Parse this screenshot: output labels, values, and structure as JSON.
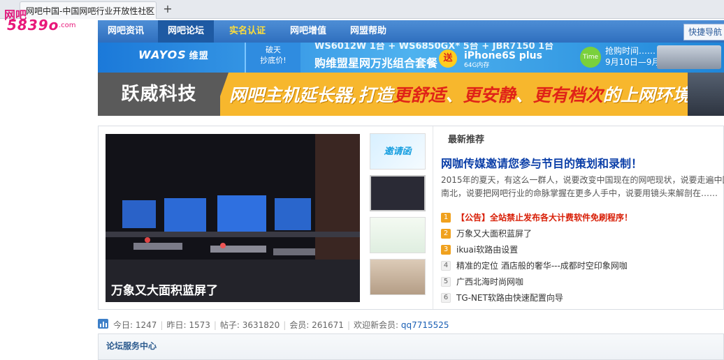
{
  "browser": {
    "tab_title": "网吧中国-中国网吧行业开放性社区",
    "tab_close": "×",
    "new_tab": "+"
  },
  "logo": {
    "line1": "网吧",
    "line2": "5839o",
    "line3": ".com"
  },
  "nav": {
    "items": [
      {
        "label": "网吧资讯"
      },
      {
        "label": "网吧论坛"
      },
      {
        "label": "实名认证"
      },
      {
        "label": "网吧增值"
      },
      {
        "label": "网盟帮助"
      }
    ],
    "right_label": "快捷导航"
  },
  "banner1": {
    "brand": "WAYOS",
    "brand_suffix": "维盟",
    "tag_line1": "破天",
    "tag_line2": "抄底价!",
    "top_text": "WS6012W 1台 + WS6850GX* 5台 + JBR7150 1台",
    "main_text": "购维盟星网万兆组合套餐",
    "song": "送",
    "phone": "iPhone6S plus",
    "phone_sub": "64G内存",
    "time_label": "Time",
    "rush_line1": "抢购时间……",
    "rush_line2": "9月10日—9月16"
  },
  "banner2": {
    "left_text": "跃威科技",
    "text_a": "网吧主机延长器,打造",
    "text_b": "更舒适",
    "text_c": "、",
    "text_d": "更安静",
    "text_e": "、",
    "text_f": "更有档次",
    "text_g": "的上网环境"
  },
  "slider": {
    "caption": "万象又大面积蓝屏了",
    "thumb1_text": "邀请函"
  },
  "recommend": {
    "title": "最新推荐",
    "headline": "网咖传媒邀请您参与节目的策划和录制！",
    "summary_line1": "2015年的夏天，有这么一群人，说要改变中国现在的网吧现状，说要走遍中国",
    "summary_line2": "南北，说要把网吧行业的命脉掌握在更多人手中，说要用镜头来解剖在……"
  },
  "hot_list": [
    {
      "num": "1",
      "text": "【公告】全站禁止发布各大计费软件免刷程序！"
    },
    {
      "num": "2",
      "text": "万象又大面积蓝屏了"
    },
    {
      "num": "3",
      "text": "ikuai软路由设置"
    },
    {
      "num": "4",
      "text": "精准的定位 酒店般的奢华---成都时空印象网咖"
    },
    {
      "num": "5",
      "text": "广西北海时尚网咖"
    },
    {
      "num": "6",
      "text": "TG-NET软路由快速配置向导"
    }
  ],
  "stats": {
    "today_label": "今日: ",
    "today": "1247",
    "yesterday_label": "昨日: ",
    "yesterday": "1573",
    "posts_label": "帖子: ",
    "posts": "3631820",
    "members_label": "会员: ",
    "members": "261671",
    "welcome_label": "欢迎新会员: ",
    "new_member": "qq7715525",
    "sep": "|"
  },
  "service": {
    "title": "论坛服务中心"
  },
  "colors": {
    "nav_blue": "#2f6fbe",
    "headline_blue": "#0b3fa8",
    "accent_orange": "#f7b72d",
    "notice_red": "#d81e06"
  }
}
